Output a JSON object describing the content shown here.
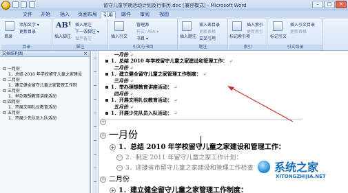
{
  "window": {
    "title": "留守儿童学期活动计划及行事历.doc [兼容模式] - Microsoft Word",
    "controls": [
      "–",
      "□",
      "✕"
    ]
  },
  "ribbon": {
    "tabs": [
      "文件",
      "开始",
      "插入",
      "页面布局",
      "引用",
      "邮件",
      "审阅",
      "视图"
    ],
    "active_tab": "引用",
    "groups": {
      "toc": {
        "label": "目录",
        "big_button": "目录",
        "items": [
          "添加文字 ▾",
          "更新目录"
        ]
      },
      "footnotes": {
        "label": "脚注",
        "big_button": "插入脚注",
        "big_glyph": "AB¹",
        "items": [
          "插入尾注",
          "下一条脚注 ▾",
          "显示备注"
        ]
      },
      "citations": {
        "label": "引文与书目",
        "big_button": "插入引文",
        "items": [
          "管理源",
          "样式: APA ▾",
          "书目 ▾"
        ]
      },
      "captions": {
        "label": "题注",
        "big_button": "插入题注",
        "items": [
          "插入表目录",
          "更新表格",
          "交叉引用"
        ]
      },
      "index": {
        "label": "索引",
        "big_button": "标记索引项",
        "items": [
          "插入索引",
          "更新索引"
        ]
      },
      "toa": {
        "label": "引文目录",
        "big_button": "标记引文",
        "items": [
          "插入引文目录",
          "更新表格"
        ]
      }
    }
  },
  "nav_pane": {
    "title": "文档结构图",
    "close": "×",
    "items": [
      {
        "text": "⊟ 一月份",
        "level": 0
      },
      {
        "text": "1．总结 2010 年学校留守儿童之家建设",
        "level": 1
      },
      {
        "text": "⊟ 二月份",
        "level": 0
      },
      {
        "text": "1．建立健全留守儿童之家管理工作制",
        "level": 1
      },
      {
        "text": "⊟ 三月份",
        "level": 0
      },
      {
        "text": "1．举办理想教育讲座活动",
        "level": 1
      },
      {
        "text": "⊟ 四月份",
        "level": 0
      },
      {
        "text": "1．开展文明礼仪教育活动",
        "level": 1
      },
      {
        "text": "⊟ 五月份",
        "level": 0
      },
      {
        "text": "1．开展少先队员入队活动",
        "level": 1
      }
    ]
  },
  "document": {
    "top_section": [
      {
        "text": "一月份",
        "style": "month"
      },
      {
        "text": "1．总结 2010 年学校留守儿童之家建设和管理工作：",
        "style": "item"
      },
      {
        "text": "二月份",
        "style": "month"
      },
      {
        "text": "1．建立健全留守儿童之家管理工作制度：",
        "style": "item"
      },
      {
        "text": "三月份",
        "style": "month"
      },
      {
        "text": "1．举办理想教育讲座活动：",
        "style": "item"
      },
      {
        "text": "四月份",
        "style": "month"
      },
      {
        "text": "1．开展文明礼仪教育活动：",
        "style": "item"
      },
      {
        "text": "五月份",
        "style": "month"
      },
      {
        "text": "1．开展少先队员入队活动：",
        "style": "item"
      }
    ],
    "paragraph_mark": "↵",
    "outline": {
      "h1": "一月份",
      "h2": "1．总结 2010 年学校留守儿童之家建设和管理工作：",
      "h3a": "2．制定 2011 年留守儿童之家工作计划：",
      "h3b": "3．迎接省市留守儿童之家建设和管理工作检查",
      "h1b": "二月份",
      "h2b": "1．建立健全留守儿童之家管理工作制度："
    }
  },
  "watermark": {
    "text": "系统之家",
    "url": "XITONGZHIJIA.NET"
  },
  "colors": {
    "ribbon_bg": "#dbe7f6",
    "accent": "#15428b",
    "annotation_arrow": "#c0302a",
    "watermark": "#1b6fb8"
  }
}
